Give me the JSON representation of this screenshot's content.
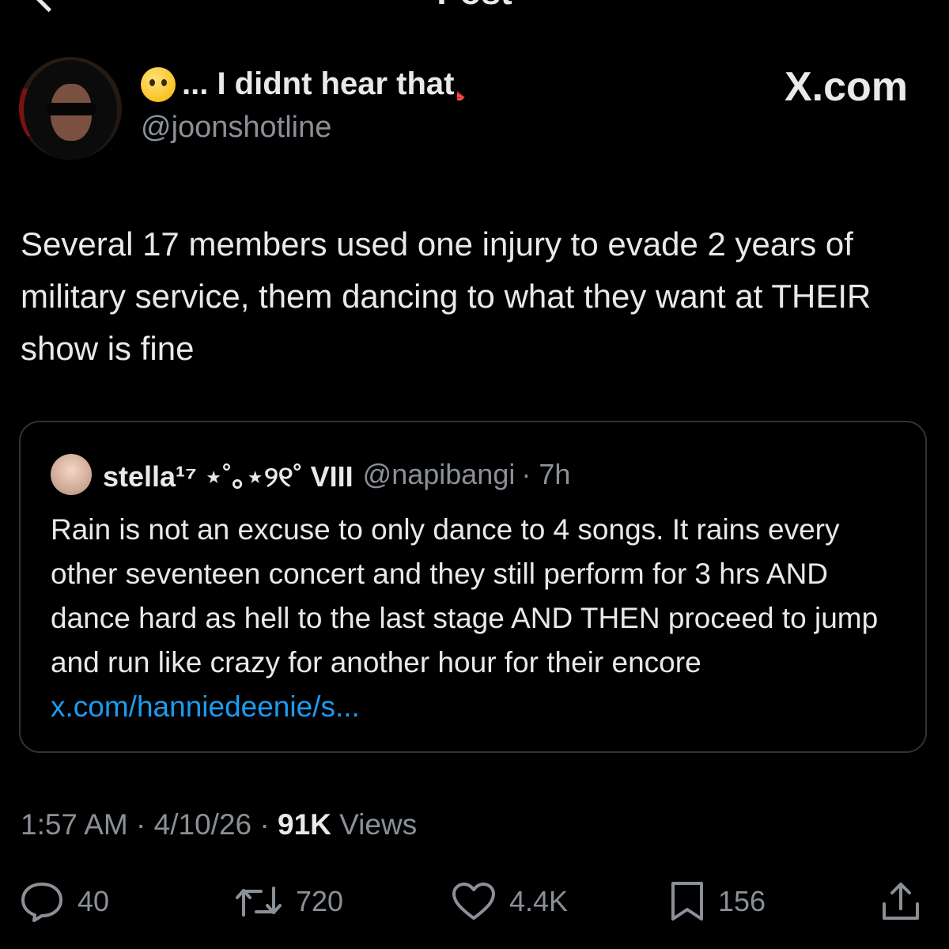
{
  "header": {
    "title": "Post"
  },
  "author": {
    "display_name": "... I didnt hear that",
    "handle": "@joonshotline",
    "brand": "X.com"
  },
  "post": {
    "text": "Several 17 members used one injury to evade 2 years of military service, them dancing to what they want at THEIR show is fine"
  },
  "quote": {
    "name": "stella¹⁷ ⋆˚｡⋆୨୧˚ VIII",
    "handle": "@napibangi",
    "time": "· 7h",
    "text": "Rain is not an excuse to only dance to 4 songs. It rains every other seventeen concert and they still perform for 3 hrs AND dance hard as hell to the last stage AND THEN proceed to jump and run like crazy for another hour for their encore ",
    "link": "x.com/hanniedeenie/s..."
  },
  "meta": {
    "time": "1:57 AM",
    "date": "4/10/26",
    "views_count": "91K",
    "views_label": "Views"
  },
  "actions": {
    "replies": "40",
    "reposts": "720",
    "likes": "4.4K",
    "bookmarks": "156"
  },
  "colors": {
    "background": "#000000",
    "text": "#e7e9ea",
    "secondary": "#8b9097",
    "link": "#1d9bf0",
    "border": "#2f3336"
  }
}
